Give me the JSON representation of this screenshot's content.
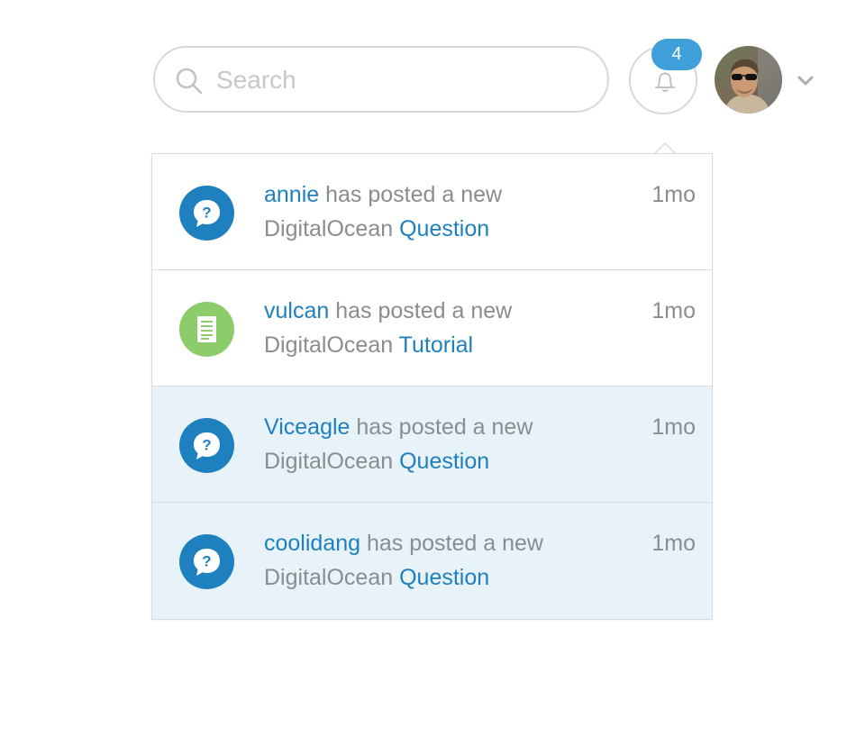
{
  "search": {
    "placeholder": "Search"
  },
  "notifications": {
    "badge_count": "4",
    "items": [
      {
        "user": "annie",
        "action": "has posted a new",
        "site": "DigitalOcean",
        "type": "Question",
        "time": "1mo",
        "icon": "question-bubble-icon",
        "unread": false
      },
      {
        "user": "vulcan",
        "action": "has posted a new",
        "site": "DigitalOcean",
        "type": "Tutorial",
        "time": "1mo",
        "icon": "document-icon",
        "unread": false
      },
      {
        "user": "Viceagle",
        "action": "has posted a new",
        "site": "DigitalOcean",
        "type": "Question",
        "time": "1mo",
        "icon": "question-bubble-icon",
        "unread": true
      },
      {
        "user": "coolidang",
        "action": "has posted a new",
        "site": "DigitalOcean",
        "type": "Question",
        "time": "1mo",
        "icon": "question-bubble-icon",
        "unread": true
      }
    ]
  },
  "icons": {
    "search": "search-icon",
    "bell": "bell-icon",
    "avatar": "user-avatar",
    "menu": "chevron-down-icon"
  },
  "colors": {
    "link": "#1f80c0",
    "muted_text": "#888d92",
    "badge": "#3e9fdb",
    "unread_bg": "#e8f2f9",
    "question_icon": "#1f80c0",
    "tutorial_icon": "#8dcc6a"
  }
}
